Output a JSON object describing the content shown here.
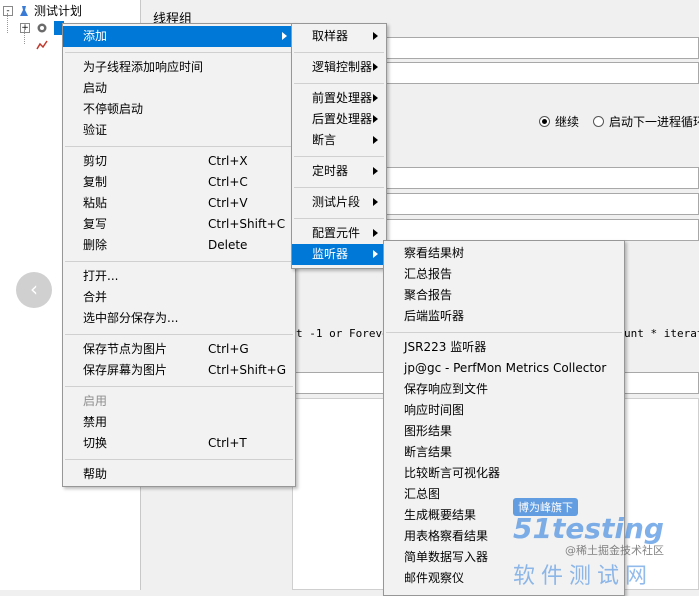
{
  "tree": {
    "root": "测试计划",
    "expand": "+",
    "collapse": "-"
  },
  "panel": {
    "title": "线程组",
    "radio_continue": "继续",
    "radio_next_loop": "启动下一进程循环",
    "loop_hint": "t -1 or Forever",
    "loop_hint_right": "unt * iterat"
  },
  "menu1": {
    "items": [
      {
        "label": "添加",
        "shortcut": "",
        "submenu": true,
        "selected": true
      },
      {
        "label": "为子线程添加响应时间",
        "shortcut": ""
      },
      {
        "label": "启动",
        "shortcut": ""
      },
      {
        "label": "不停顿启动",
        "shortcut": ""
      },
      {
        "label": "验证",
        "shortcut": ""
      },
      {
        "label": "剪切",
        "shortcut": "Ctrl+X"
      },
      {
        "label": "复制",
        "shortcut": "Ctrl+C"
      },
      {
        "label": "粘贴",
        "shortcut": "Ctrl+V"
      },
      {
        "label": "复写",
        "shortcut": "Ctrl+Shift+C"
      },
      {
        "label": "删除",
        "shortcut": "Delete"
      },
      {
        "label": "打开...",
        "shortcut": ""
      },
      {
        "label": "合并",
        "shortcut": ""
      },
      {
        "label": "选中部分保存为...",
        "shortcut": ""
      },
      {
        "label": "保存节点为图片",
        "shortcut": "Ctrl+G"
      },
      {
        "label": "保存屏幕为图片",
        "shortcut": "Ctrl+Shift+G"
      },
      {
        "label": "启用",
        "shortcut": "",
        "disabled": true
      },
      {
        "label": "禁用",
        "shortcut": ""
      },
      {
        "label": "切换",
        "shortcut": "Ctrl+T"
      },
      {
        "label": "帮助",
        "shortcut": ""
      }
    ]
  },
  "menu2": {
    "items": [
      {
        "label": "取样器"
      },
      {
        "label": "逻辑控制器"
      },
      {
        "label": "前置处理器"
      },
      {
        "label": "后置处理器"
      },
      {
        "label": "断言"
      },
      {
        "label": "定时器"
      },
      {
        "label": "测试片段"
      },
      {
        "label": "配置元件"
      },
      {
        "label": "监听器",
        "selected": true
      }
    ]
  },
  "menu3": {
    "items": [
      "察看结果树",
      "汇总报告",
      "聚合报告",
      "后端监听器",
      "JSR223 监听器",
      "jp@gc - PerfMon Metrics Collector",
      "保存响应到文件",
      "响应时间图",
      "图形结果",
      "断言结果",
      "比较断言可视化器",
      "汇总图",
      "生成概要结果",
      "用表格察看结果",
      "简单数据写入器",
      "邮件观察仪"
    ]
  },
  "watermark": {
    "tag": "博为峰旗下",
    "logo": "51testing",
    "sub": "软件测试网",
    "credit": "@稀土掘金技术社区"
  },
  "nav": {
    "prev": "‹"
  }
}
